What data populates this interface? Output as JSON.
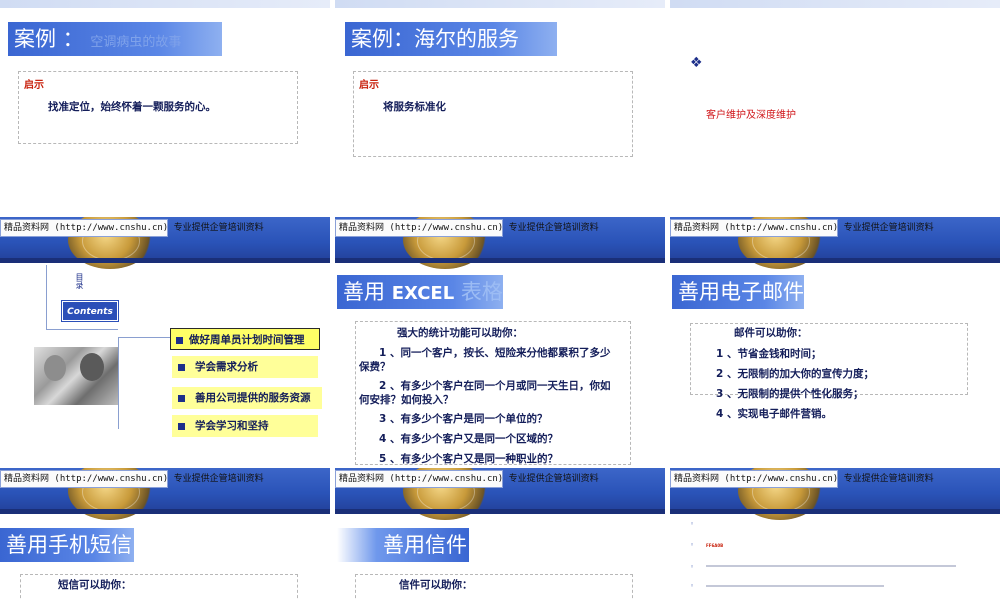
{
  "banner": {
    "site_text": "精品资料网 (http://www.cnshu.cn) 专业提供企管培训资料"
  },
  "slide1": {
    "title_main": "案例 ：",
    "title_faint": "空调病虫的故事",
    "section_label": "启示",
    "body": "找准定位，始终怀着一颗服务的心。"
  },
  "slide2": {
    "title": "案例：海尔的服务",
    "section_label": "启示",
    "body": "将服务标准化"
  },
  "slide3": {
    "diamond": "❖",
    "red_text": "客户维护及深度维护"
  },
  "slide4": {
    "vertical_label": "目录",
    "contents_label": "Contents",
    "items": [
      "做好周单员计划时间管理",
      "学会需求分析",
      "善用公司提供的服务资源",
      "学会学习和坚持"
    ]
  },
  "slide5": {
    "title_main": "善用",
    "title_bold": "EXCEL",
    "title_faint": "表格",
    "intro": "强大的统计功能可以助你：",
    "lines": [
      "1 、同一个客户，按长、短险来分他都累积了多少",
      "保费？",
      "2 、有多少个客户在同一个月或同一天生日，你如",
      "何安排？如何投入？",
      "3 、有多少个客户是同一个单位的？",
      "4 、有多少个客户又是同一个区域的？",
      "5 、有多少个客户又是同一种职业的？"
    ]
  },
  "slide6": {
    "title": "善用电子邮件",
    "intro": "邮件可以助你：",
    "lines": [
      "1 、节省金钱和时间；",
      "2 、无限制的加大你的宣传力度；",
      "3 、无限制的提供个性化服务；",
      "4 、实现电子邮件营销。"
    ]
  },
  "slide7": {
    "title": "善用手机短信",
    "intro": "短信可以助你："
  },
  "slide8": {
    "title": "善用信件",
    "intro": "信件可以助你："
  },
  "slide9": {
    "bullet": "◦",
    "heading": "FF6A0B",
    "line1": "",
    "line2": ""
  }
}
